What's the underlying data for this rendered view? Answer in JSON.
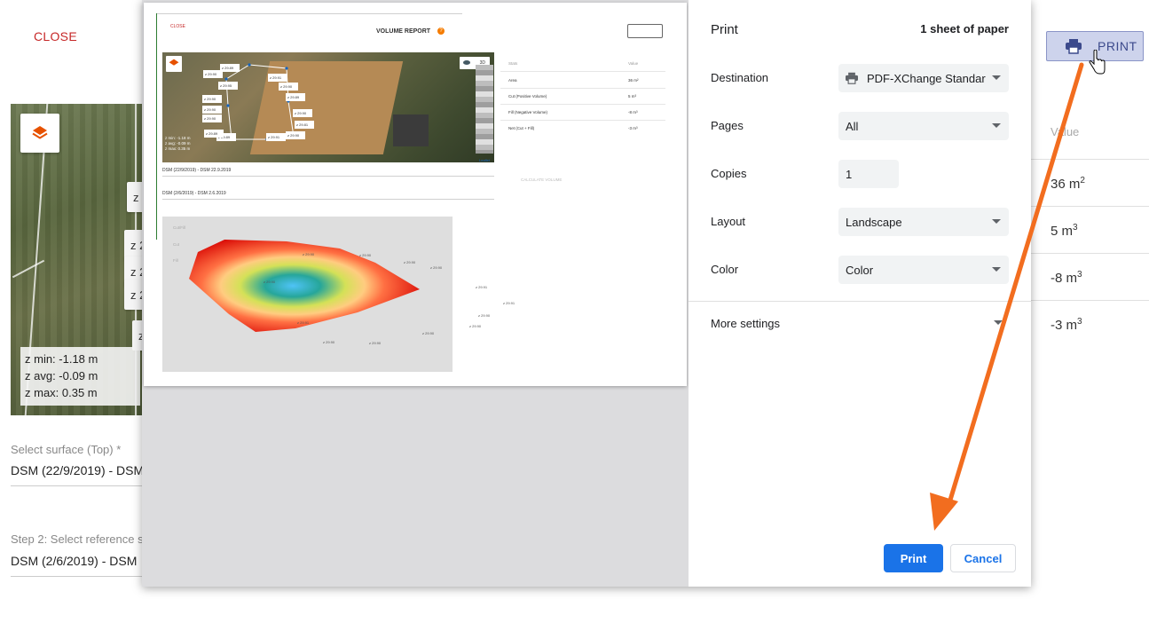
{
  "background": {
    "close_label": "CLOSE",
    "map": {
      "z_chip": "z",
      "z_chip_cut": "z 2",
      "z_min": "z min: -1.18 m",
      "z_avg": "z avg: -0.09 m",
      "z_max": "z max: 0.35 m"
    },
    "top_surface_label": "Select surface (Top) *",
    "top_surface_value": "DSM (22/9/2019) - DSM",
    "reference_label": "Step 2: Select reference s",
    "reference_value": "DSM (2/6/2019) - DSM",
    "print_button_label": "PRINT",
    "table": {
      "header": "Value",
      "rows": [
        {
          "value": "36 m",
          "unit_exp": "2"
        },
        {
          "value": "5 m",
          "unit_exp": "3"
        },
        {
          "value": "-8 m",
          "unit_exp": "3"
        },
        {
          "value": "-3 m",
          "unit_exp": "3"
        }
      ]
    }
  },
  "print_dialog": {
    "title": "Print",
    "sheets": "1 sheet of paper",
    "destination_label": "Destination",
    "destination_value": "PDF-XChange Standar",
    "pages_label": "Pages",
    "pages_value": "All",
    "copies_label": "Copies",
    "copies_value": "1",
    "layout_label": "Layout",
    "layout_value": "Landscape",
    "color_label": "Color",
    "color_value": "Color",
    "more_settings_label": "More settings",
    "print_button": "Print",
    "cancel_button": "Cancel",
    "accent_color": "#1a73e8"
  },
  "preview": {
    "close": "CLOSE",
    "title": "VOLUME REPORT",
    "help": "?",
    "three_d": "3D",
    "leaflet": "Leaflet",
    "z_stats": [
      "z min: -1.18 m",
      "z avg: -0.09 m",
      "z max: 0.35 m"
    ],
    "chips": [
      "z 29.90",
      "z 29.95",
      "z 29.90",
      "z 29.90",
      "z 29.90",
      "z 29.89",
      "z 29.91",
      "z 29.90",
      "z 29.89",
      "z 29.90",
      "z 29.81",
      "z 29.90",
      "z 29.91",
      "z 29.89",
      "z 29.89",
      "z 29.90",
      "z 29.90",
      "z 29.92",
      "z 29.90"
    ],
    "table_header_stats": "Stats",
    "table_header_value": "Value",
    "table_rows": [
      {
        "stat": "Area",
        "value": "36 m²"
      },
      {
        "stat": "Cut (Positive Volume)",
        "value": "5 m³"
      },
      {
        "stat": "Fill (Negative Volume)",
        "value": "-8 m³"
      },
      {
        "stat": "Net (Cut + Fill)",
        "value": "-3 m³"
      }
    ],
    "select_top": "DSM (22/9/2019) - DSM 22.9.2019",
    "select_ref": "DSM (2/6/2019) - DSM 2.6.2019",
    "calculate": "CALCULATE VOLUME",
    "legend": [
      "Cut/Fill",
      "Cut",
      "Fill"
    ],
    "points": [
      "z 29.90",
      "z 29.90",
      "z 29.90",
      "z 29.90",
      "z 29.91",
      "z 29.91",
      "z 29.90",
      "z 29.90",
      "z 29.90",
      "z 29.91",
      "z 29.90",
      "z 29.90",
      "z 29.90"
    ]
  }
}
